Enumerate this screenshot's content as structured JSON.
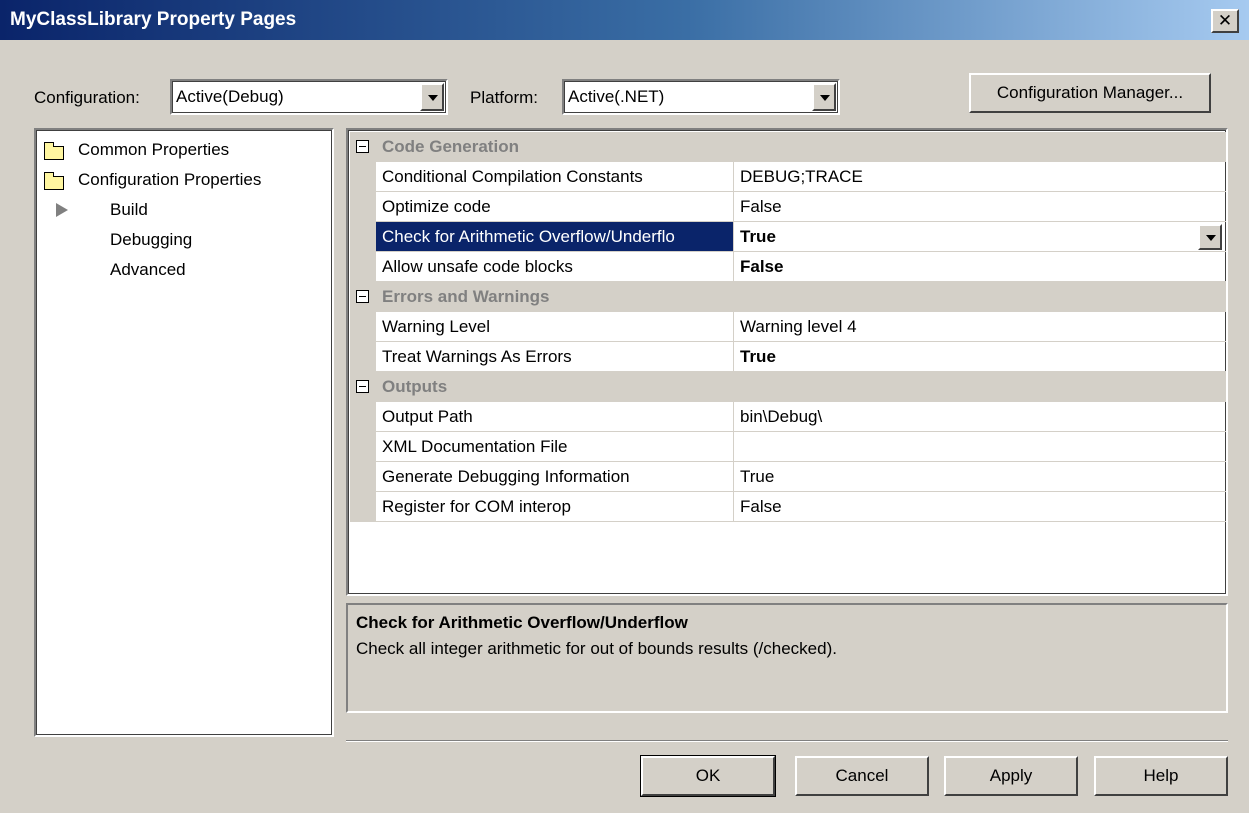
{
  "window": {
    "title": "MyClassLibrary Property Pages",
    "close_glyph": "✕"
  },
  "toolbar": {
    "configuration_label": "Configuration:",
    "configuration_value": "Active(Debug)",
    "platform_label": "Platform:",
    "platform_value": "Active(.NET)",
    "config_manager_label": "Configuration Manager..."
  },
  "tree": {
    "items": [
      {
        "label": "Common Properties",
        "icon": "folder-icon"
      },
      {
        "label": "Configuration Properties",
        "icon": "folder-open-icon"
      },
      {
        "label": "Build",
        "icon": "arrow-right-icon",
        "selected": true
      },
      {
        "label": "Debugging"
      },
      {
        "label": "Advanced"
      }
    ]
  },
  "grid": {
    "categories": [
      {
        "label": "Code Generation",
        "properties": [
          {
            "name": "Conditional Compilation Constants",
            "value": "DEBUG;TRACE",
            "bold": false
          },
          {
            "name": "Optimize code",
            "value": "False",
            "bold": false
          },
          {
            "name": "Check for Arithmetic Overflow/Underflo",
            "value": "True",
            "bold": true,
            "selected": true
          },
          {
            "name": "Allow unsafe code blocks",
            "value": "False",
            "bold": true
          }
        ]
      },
      {
        "label": "Errors and Warnings",
        "properties": [
          {
            "name": "Warning Level",
            "value": "Warning level 4",
            "bold": false
          },
          {
            "name": "Treat Warnings As Errors",
            "value": "True",
            "bold": true
          }
        ]
      },
      {
        "label": "Outputs",
        "properties": [
          {
            "name": "Output Path",
            "value": "bin\\Debug\\",
            "bold": false
          },
          {
            "name": "XML Documentation File",
            "value": "",
            "bold": false
          },
          {
            "name": "Generate Debugging Information",
            "value": "True",
            "bold": false
          },
          {
            "name": "Register for COM interop",
            "value": "False",
            "bold": false
          }
        ]
      }
    ]
  },
  "description": {
    "title": "Check for Arithmetic Overflow/Underflow",
    "text": "Check all integer arithmetic for out of bounds results (/checked)."
  },
  "buttons": {
    "ok": "OK",
    "cancel": "Cancel",
    "apply": "Apply",
    "help": "Help"
  },
  "colors": {
    "selection": "#0a246a",
    "face": "#d4d0c8",
    "category_text": "#808080"
  }
}
